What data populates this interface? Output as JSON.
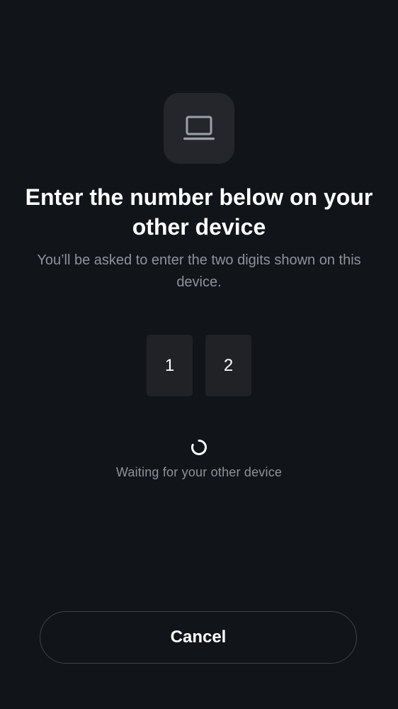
{
  "header": {
    "icon": "laptop-icon",
    "title": "Enter the number below on your other device",
    "subtitle": "You’ll be asked to enter the two digits shown on this device."
  },
  "code": {
    "digits": [
      "1",
      "2"
    ]
  },
  "status": {
    "spinner_icon": "loading-spinner-icon",
    "text": "Waiting for your other device"
  },
  "actions": {
    "cancel_label": "Cancel"
  },
  "colors": {
    "background": "#111418",
    "tile": "#24262b",
    "digit_box": "#202226",
    "secondary_text": "#8e939a",
    "button_border": "#3f4247"
  }
}
